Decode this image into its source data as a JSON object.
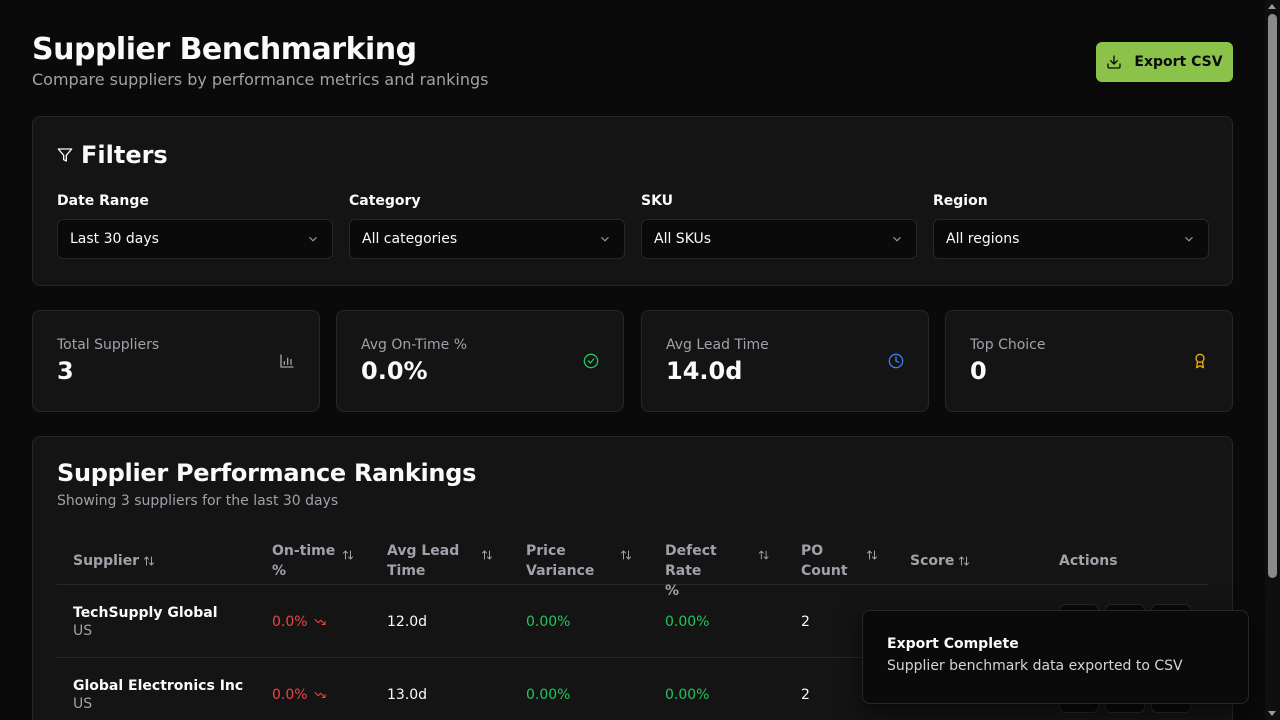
{
  "header": {
    "title": "Supplier Benchmarking",
    "subtitle": "Compare suppliers by performance metrics and rankings",
    "export_label": "Export CSV"
  },
  "filters": {
    "title": "Filters",
    "date_range": {
      "label": "Date Range",
      "value": "Last 30 days"
    },
    "category": {
      "label": "Category",
      "value": "All categories"
    },
    "sku": {
      "label": "SKU",
      "value": "All SKUs"
    },
    "region": {
      "label": "Region",
      "value": "All regions"
    }
  },
  "stats": [
    {
      "label": "Total Suppliers",
      "value": "3",
      "icon": "bar-chart-icon",
      "color": "#a1a1aa"
    },
    {
      "label": "Avg On-Time %",
      "value": "0.0%",
      "icon": "check-circle-icon",
      "color": "#22c55e"
    },
    {
      "label": "Avg Lead Time",
      "value": "14.0d",
      "icon": "clock-icon",
      "color": "#3b82f6"
    },
    {
      "label": "Top Choice",
      "value": "0",
      "icon": "award-icon",
      "color": "#eab308"
    }
  ],
  "rankings": {
    "title": "Supplier Performance Rankings",
    "subtitle": "Showing 3 suppliers for the last 30 days",
    "columns": {
      "supplier": "Supplier",
      "ontime_1": "On-time",
      "ontime_2": "%",
      "lead_1": "Avg Lead",
      "lead_2": "Time",
      "price_1": "Price",
      "price_2": "Variance",
      "defect_1": "Defect Rate",
      "defect_2": "%",
      "po_1": "PO",
      "po_2": "Count",
      "score": "Score",
      "actions": "Actions"
    },
    "rows": [
      {
        "name": "TechSupply Global",
        "region": "US",
        "ontime": "0.0%",
        "lead": "12.0d",
        "price": "0.00%",
        "defect": "0.00%",
        "po": "2"
      },
      {
        "name": "Global Electronics Inc",
        "region": "US",
        "ontime": "0.0%",
        "lead": "13.0d",
        "price": "0.00%",
        "defect": "0.00%",
        "po": "2"
      }
    ]
  },
  "toast": {
    "title": "Export Complete",
    "description": "Supplier benchmark data exported to CSV"
  }
}
